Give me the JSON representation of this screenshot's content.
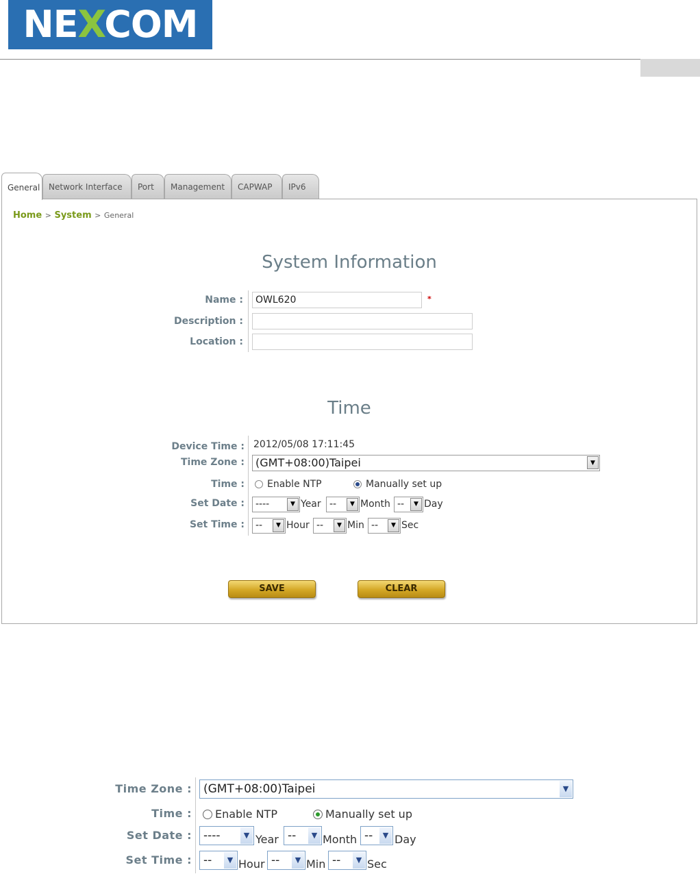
{
  "logo": {
    "part1": "NE",
    "part2": "X",
    "part3": "COM"
  },
  "tabs": [
    {
      "label": "General",
      "active": true
    },
    {
      "label": "Network Interface",
      "active": false
    },
    {
      "label": "Port",
      "active": false
    },
    {
      "label": "Management",
      "active": false
    },
    {
      "label": "CAPWAP",
      "active": false
    },
    {
      "label": "IPv6",
      "active": false
    }
  ],
  "breadcrumb": {
    "home": "Home",
    "sep1": ">",
    "system": "System",
    "sep2": ">",
    "current": "General"
  },
  "system_info": {
    "title": "System Information",
    "name_label": "Name :",
    "name_value": "OWL620",
    "required_mark": "*",
    "description_label": "Description :",
    "description_value": "",
    "location_label": "Location :",
    "location_value": ""
  },
  "time": {
    "title": "Time",
    "device_time_label": "Device Time :",
    "device_time_value": "2012/05/08 17:11:45",
    "time_zone_label": "Time Zone :",
    "time_zone_value": "(GMT+08:00)Taipei",
    "time_label": "Time :",
    "enable_ntp": "Enable NTP",
    "manual_setup": "Manually set up",
    "selected_mode": "manual",
    "set_date_label": "Set Date :",
    "year_value": "----",
    "year_unit": "Year",
    "month_value": "--",
    "month_unit": "Month",
    "day_value": "--",
    "day_unit": "Day",
    "set_time_label": "Set Time :",
    "hour_value": "--",
    "hour_unit": "Hour",
    "min_value": "--",
    "min_unit": "Min",
    "sec_value": "--",
    "sec_unit": "Sec"
  },
  "buttons": {
    "save": "SAVE",
    "clear": "CLEAR"
  },
  "colors": {
    "brand_blue": "#2a6fb2",
    "brand_green": "#8bc43f",
    "breadcrumb_green": "#7a9a1a",
    "button_gold": "#d4a826"
  },
  "icons": {
    "dropdown": "chevron-down-icon",
    "radio": "radio-icon"
  }
}
